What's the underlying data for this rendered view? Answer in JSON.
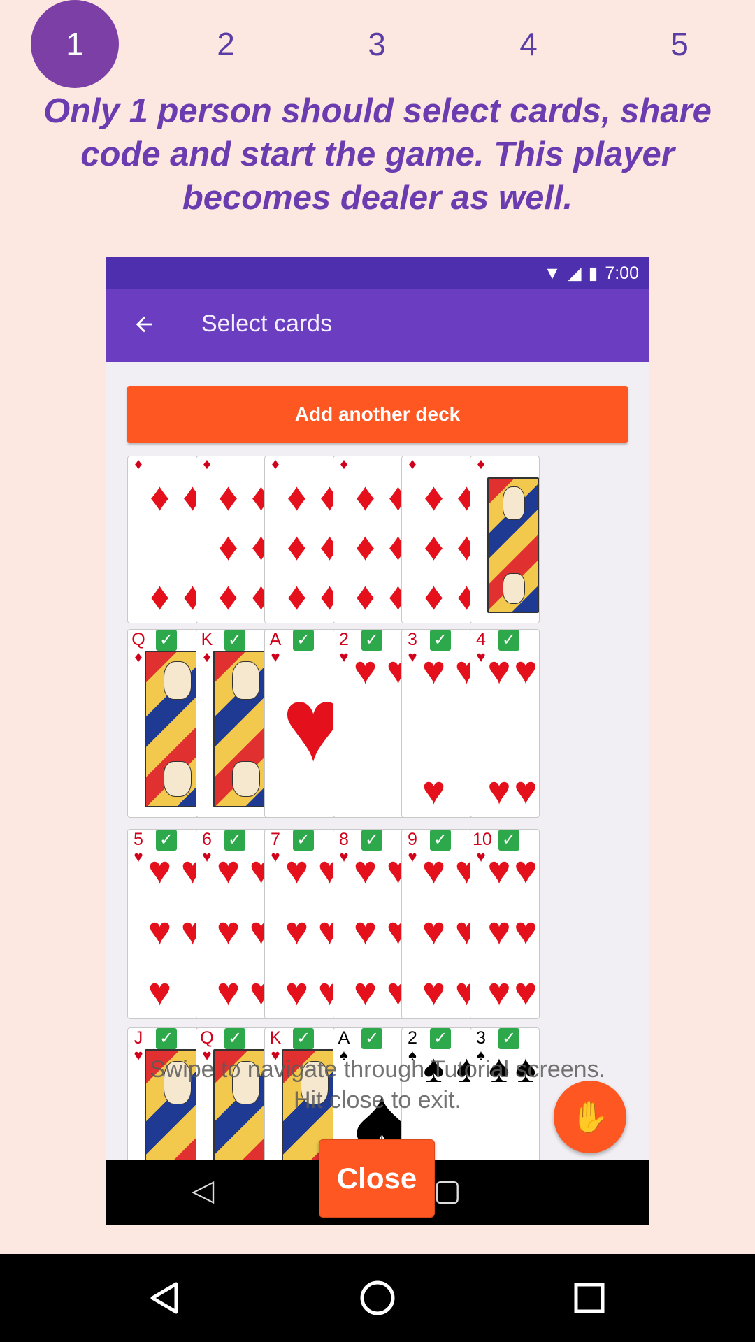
{
  "steps": [
    "1",
    "2",
    "3",
    "4",
    "5"
  ],
  "active_step": "1",
  "headline": "Only 1 person should select cards, share code and start the game. This player becomes dealer as well.",
  "phone": {
    "status_time": "7:00",
    "appbar_title": "Select cards",
    "back_icon": "arrow-left-icon",
    "add_deck_label": "Add another deck",
    "cards": {
      "row0": [
        {
          "rank": "",
          "suit": "♦",
          "color": "red",
          "pips": 4
        },
        {
          "rank": "",
          "suit": "♦",
          "color": "red",
          "pips": 6
        },
        {
          "rank": "",
          "suit": "♦",
          "color": "red",
          "pips": 7
        },
        {
          "rank": "",
          "suit": "♦",
          "color": "red",
          "pips": 8
        },
        {
          "rank": "",
          "suit": "♦",
          "color": "red",
          "pips": 8
        },
        {
          "rank": "",
          "suit": "♦",
          "color": "red",
          "face": true
        }
      ],
      "row1": [
        {
          "rank": "Q",
          "suit": "♦",
          "color": "red",
          "face": true,
          "checked": true
        },
        {
          "rank": "K",
          "suit": "♦",
          "color": "red",
          "face": true,
          "checked": true
        },
        {
          "rank": "A",
          "suit": "♥",
          "color": "red",
          "ace": true,
          "checked": true
        },
        {
          "rank": "2",
          "suit": "♥",
          "color": "red",
          "pips": 2,
          "checked": true
        },
        {
          "rank": "3",
          "suit": "♥",
          "color": "red",
          "pips": 3,
          "checked": true
        },
        {
          "rank": "4",
          "suit": "♥",
          "color": "red",
          "pips": 4,
          "checked": true
        }
      ],
      "row2": [
        {
          "rank": "5",
          "suit": "♥",
          "color": "red",
          "pips": 5,
          "checked": true
        },
        {
          "rank": "6",
          "suit": "♥",
          "color": "red",
          "pips": 6,
          "checked": true
        },
        {
          "rank": "7",
          "suit": "♥",
          "color": "red",
          "pips": 7,
          "checked": true
        },
        {
          "rank": "8",
          "suit": "♥",
          "color": "red",
          "pips": 8,
          "checked": true
        },
        {
          "rank": "9",
          "suit": "♥",
          "color": "red",
          "pips": 9,
          "checked": true
        },
        {
          "rank": "10",
          "suit": "♥",
          "color": "red",
          "pips": 10,
          "checked": true
        }
      ],
      "row3": [
        {
          "rank": "J",
          "suit": "♥",
          "color": "red",
          "face": true,
          "checked": true
        },
        {
          "rank": "Q",
          "suit": "♥",
          "color": "red",
          "face": true,
          "checked": true
        },
        {
          "rank": "K",
          "suit": "♥",
          "color": "red",
          "face": true,
          "checked": true
        },
        {
          "rank": "A",
          "suit": "♠",
          "color": "black",
          "ace": true,
          "checked": true
        },
        {
          "rank": "2",
          "suit": "♠",
          "color": "black",
          "pips": 2,
          "checked": true
        },
        {
          "rank": "3",
          "suit": "♠",
          "color": "black",
          "pips": 3,
          "checked": true
        }
      ]
    },
    "hint_line1": "Swipe to navigate through Tutorial screens.",
    "hint_line2": "Hit close to exit."
  },
  "close_label": "Close",
  "colors": {
    "background": "#fde8e1",
    "accent_purple": "#6a3cb0",
    "accent_orange": "#ff5722",
    "check_green": "#2da84a"
  }
}
